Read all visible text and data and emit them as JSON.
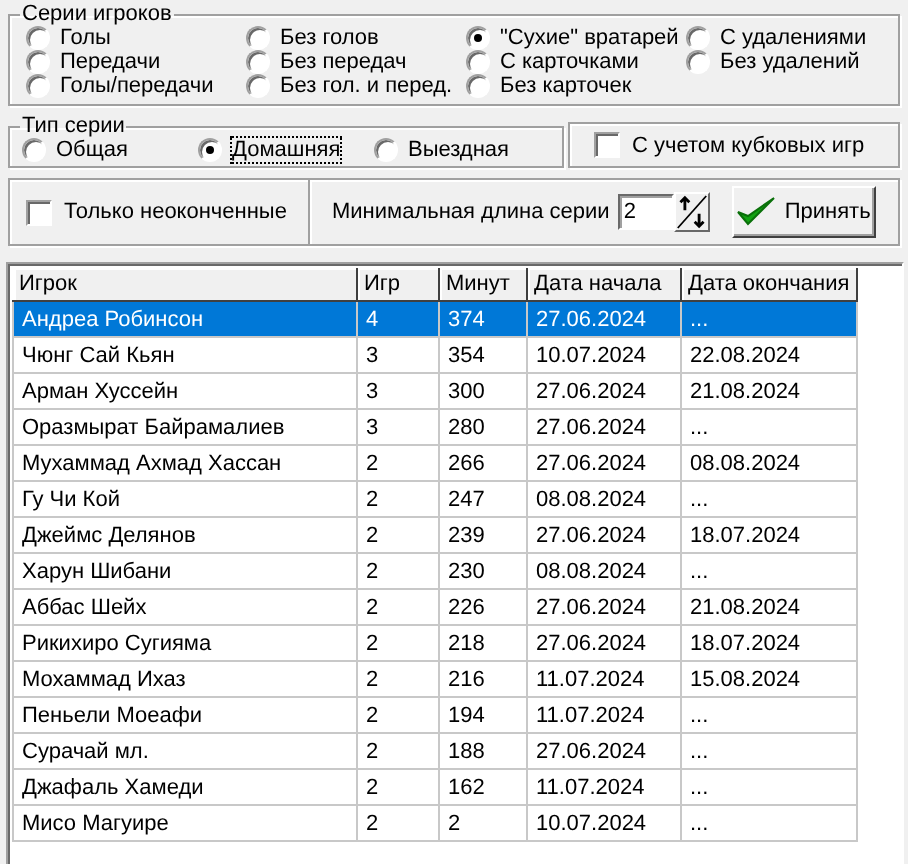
{
  "player_series": {
    "title": "Серии игроков",
    "options": [
      {
        "label": "Голы",
        "selected": false
      },
      {
        "label": "Передачи",
        "selected": false
      },
      {
        "label": "Голы/передачи",
        "selected": false
      },
      {
        "label": "Без голов",
        "selected": false
      },
      {
        "label": "Без передач",
        "selected": false
      },
      {
        "label": "Без гол. и перед.",
        "selected": false
      },
      {
        "label": "\"Сухие\" вратарей",
        "selected": true
      },
      {
        "label": "С карточками",
        "selected": false
      },
      {
        "label": "Без карточек",
        "selected": false
      },
      {
        "label": "С удалениями",
        "selected": false
      },
      {
        "label": "Без удалений",
        "selected": false
      }
    ]
  },
  "series_type": {
    "title": "Тип серии",
    "options": [
      {
        "label": "Общая",
        "selected": false
      },
      {
        "label": "Домашняя",
        "selected": true
      },
      {
        "label": "Выездная",
        "selected": false
      }
    ]
  },
  "include_cup_games": {
    "label": "С учетом кубковых игр",
    "checked": false
  },
  "only_unfinished": {
    "label": "Только неоконченные",
    "checked": false
  },
  "min_length": {
    "label": "Минимальная длина серии",
    "value": "2"
  },
  "apply_button": {
    "label": "Принять"
  },
  "table": {
    "columns": [
      "Игрок",
      "Игр",
      "Минут",
      "Дата начала",
      "Дата окончания"
    ],
    "rows": [
      {
        "cells": [
          "Андреа Робинсон",
          "4",
          "374",
          "27.06.2024",
          "..."
        ],
        "selected": true
      },
      {
        "cells": [
          "Чюнг Сай Кьян",
          "3",
          "354",
          "10.07.2024",
          "22.08.2024"
        ],
        "selected": false
      },
      {
        "cells": [
          "Арман Хуссейн",
          "3",
          "300",
          "27.06.2024",
          "21.08.2024"
        ],
        "selected": false
      },
      {
        "cells": [
          "Оразмырат Байрамалиев",
          "3",
          "280",
          "27.06.2024",
          "..."
        ],
        "selected": false
      },
      {
        "cells": [
          "Мухаммад Ахмад Хассан",
          "2",
          "266",
          "27.06.2024",
          "08.08.2024"
        ],
        "selected": false
      },
      {
        "cells": [
          "Гу Чи Кой",
          "2",
          "247",
          "08.08.2024",
          "..."
        ],
        "selected": false
      },
      {
        "cells": [
          "Джеймс Делянов",
          "2",
          "239",
          "27.06.2024",
          "18.07.2024"
        ],
        "selected": false
      },
      {
        "cells": [
          "Харун Шибани",
          "2",
          "230",
          "08.08.2024",
          "..."
        ],
        "selected": false
      },
      {
        "cells": [
          "Аббас Шейх",
          "2",
          "226",
          "27.06.2024",
          "21.08.2024"
        ],
        "selected": false
      },
      {
        "cells": [
          "Рикихиро Сугияма",
          "2",
          "218",
          "27.06.2024",
          "18.07.2024"
        ],
        "selected": false
      },
      {
        "cells": [
          "Мохаммад Ихаз",
          "2",
          "216",
          "11.07.2024",
          "15.08.2024"
        ],
        "selected": false
      },
      {
        "cells": [
          "Пеньели Моеафи",
          "2",
          "194",
          "11.07.2024",
          "..."
        ],
        "selected": false
      },
      {
        "cells": [
          "Сурачай мл.",
          "2",
          "188",
          "27.06.2024",
          "..."
        ],
        "selected": false
      },
      {
        "cells": [
          "Джафаль Хамеди",
          "2",
          "162",
          "11.07.2024",
          "..."
        ],
        "selected": false
      },
      {
        "cells": [
          "Мисо Магуире",
          "2",
          "2",
          "10.07.2024",
          "..."
        ],
        "selected": false
      }
    ]
  }
}
